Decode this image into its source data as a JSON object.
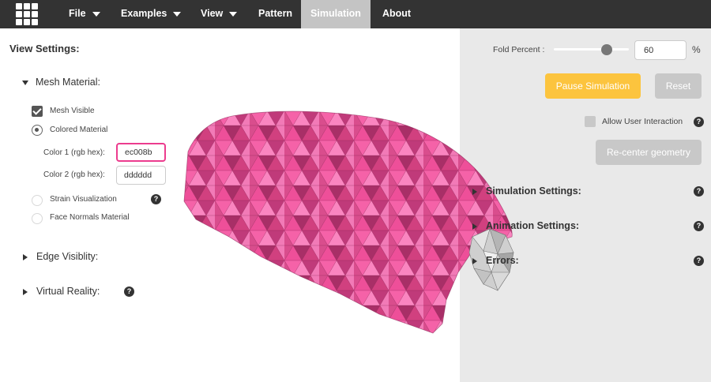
{
  "nav": {
    "items": [
      {
        "label": "File",
        "dropdown": true
      },
      {
        "label": "Examples",
        "dropdown": true
      },
      {
        "label": "View",
        "dropdown": true
      },
      {
        "label": "Pattern",
        "dropdown": false
      },
      {
        "label": "Simulation",
        "dropdown": false,
        "active": true
      },
      {
        "label": "About",
        "dropdown": false
      }
    ]
  },
  "view_settings": {
    "title": "View Settings:",
    "mesh_material": {
      "label": "Mesh Material:",
      "mesh_visible": {
        "label": "Mesh Visible",
        "checked": true
      },
      "colored_material": {
        "label": "Colored Material",
        "selected": true
      },
      "color1": {
        "label": "Color 1 (rgb hex):",
        "value": "ec008b"
      },
      "color2": {
        "label": "Color 2 (rgb hex):",
        "value": "dddddd"
      },
      "strain_visualization": {
        "label": "Strain Visualization",
        "selected": false
      },
      "face_normals": {
        "label": "Face Normals Material",
        "selected": false
      }
    },
    "edge_visibility": {
      "label": "Edge Visiblity:"
    },
    "virtual_reality": {
      "label": "Virtual Reality:"
    }
  },
  "simulation_panel": {
    "fold_percent_label": "Fold Percent :",
    "fold_percent_value": "60",
    "fold_percent_fraction": 0.6,
    "percent_sign": "%",
    "pause_button": "Pause Simulation",
    "reset_button": "Reset",
    "allow_user_interaction": {
      "label": "Allow User Interaction",
      "checked": false
    },
    "recenter_button": "Re-center geometry",
    "sections": [
      "Simulation Settings:",
      "Animation Settings:",
      "Errors:"
    ]
  },
  "help_glyph": "?",
  "colors": {
    "nav_bg": "#333333",
    "nav_active": "#c4c4c4",
    "accent_yellow": "#fcc43e",
    "mesh_color1": "#ec008b",
    "mesh_color2": "#dddddd",
    "panel_bg": "#e9e9e9"
  },
  "icons": {
    "logo": "grid-logo-icon",
    "dropdown": "caret-down-icon",
    "help": "question-mark-icon",
    "expand": "triangle-right-icon",
    "collapse": "triangle-down-icon"
  }
}
